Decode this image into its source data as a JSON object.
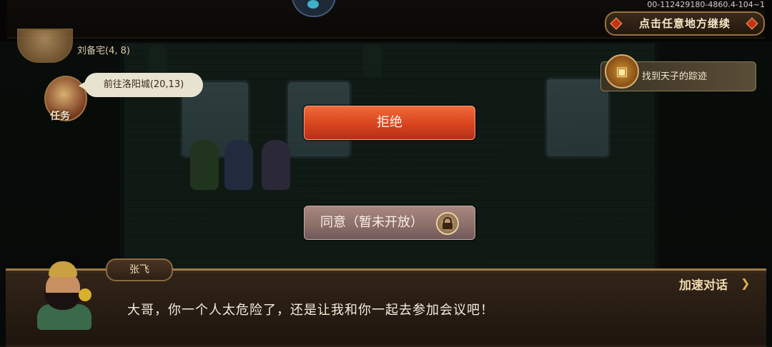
{
  "top_bar": {
    "build_id": "00-112429180-4860.4-104~1",
    "continue_label": "点击任意地方继续"
  },
  "player": {
    "location": "刘备宅(4, 8)"
  },
  "task": {
    "icon_label": "任务",
    "bubble_text": "前往洛阳城(20,13)"
  },
  "quest": {
    "text": "找到天子的踪迹"
  },
  "choices": {
    "refuse_label": "拒绝",
    "agree_label": "同意（暂未开放）"
  },
  "dialog": {
    "speaker": "张飞",
    "text": "大哥，你一个人太危险了，还是让我和你一起去参加会议吧！",
    "speedup_label": "加速对话"
  },
  "colors": {
    "refuse_button": "#d8441e",
    "agree_button": "#8a6e68",
    "dialog_panel": "#2a1d14",
    "accent_gold": "#a07a48"
  },
  "icons": {
    "lock": "lock-icon",
    "speedup": "chevron-right-icon",
    "quest": "treasure-chest-icon",
    "task": "scroll-icon"
  }
}
